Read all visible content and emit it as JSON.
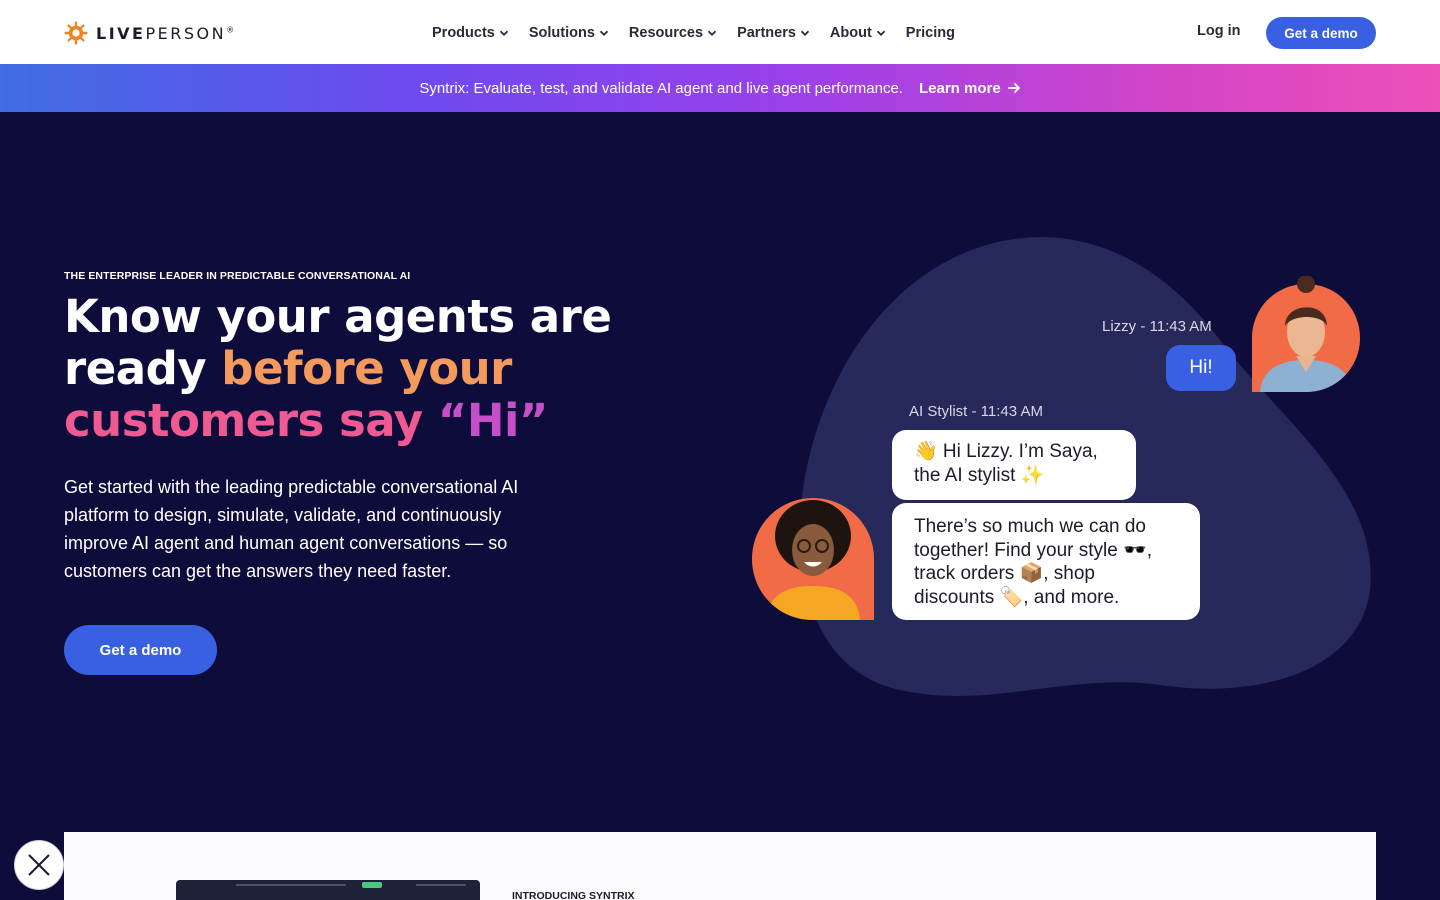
{
  "header": {
    "logo_text_bold": "LIVE",
    "logo_text_light": "PERSON",
    "logo_mark": "®",
    "nav": [
      {
        "label": "Products",
        "has_dropdown": true
      },
      {
        "label": "Solutions",
        "has_dropdown": true
      },
      {
        "label": "Resources",
        "has_dropdown": true
      },
      {
        "label": "Partners",
        "has_dropdown": true
      },
      {
        "label": "About",
        "has_dropdown": true
      },
      {
        "label": "Pricing",
        "has_dropdown": false
      }
    ],
    "login_label": "Log in",
    "demo_label": "Get a demo"
  },
  "banner": {
    "text": "Syntrix: Evaluate, test, and validate AI agent and live agent performance.",
    "link_label": "Learn more"
  },
  "hero": {
    "eyebrow": "THE ENTERPRISE LEADER IN PREDICTABLE CONVERSATIONAL AI",
    "headline_part1": "Know your agents are ready ",
    "headline_part2": "before your ",
    "headline_part3": "customers say ",
    "headline_part4": "“Hi”",
    "body": "Get started with the leading predictable conversational AI platform to design, simulate, validate, and continuously improve AI agent and human agent conversations — so customers can get the answers they need faster.",
    "cta_label": "Get a demo"
  },
  "chat": {
    "lizzy_meta": "Lizzy - 11:43 AM",
    "lizzy_message": "Hi!",
    "stylist_meta": "AI Stylist - 11:43 AM",
    "stylist_message_1": "👋 Hi Lizzy. I’m Saya, the AI stylist ✨",
    "stylist_message_2": "There’s so much we can do together! Find your style 🕶️, track orders 📦, shop discounts 🏷️, and more."
  },
  "bottom_card": {
    "eyebrow": "INTRODUCING SYNTRIX"
  },
  "colors": {
    "page_bg": "#0e0c3b",
    "brand_blue": "#3960e1",
    "accent_orange": "#f49a5c",
    "accent_pink": "#ee5a91",
    "accent_purple": "#c74ec9",
    "logo_orange": "#f08322"
  },
  "icons": {
    "logo": "liveperson-sun-icon",
    "dropdown": "chevron-down-icon",
    "arrow": "arrow-right-icon",
    "close": "close-icon"
  }
}
